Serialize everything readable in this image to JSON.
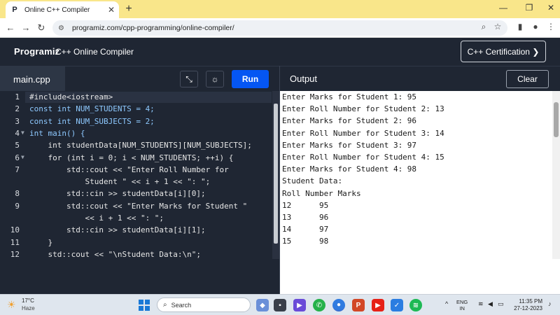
{
  "browser": {
    "tab_title": "Online C++ Compiler",
    "url": "programiz.com/cpp-programming/online-compiler/"
  },
  "site": {
    "logo": "Programiz",
    "title": "C++ Online Compiler",
    "cert_button": "C++ Certification ❯"
  },
  "editor": {
    "filename": "main.cpp",
    "run_label": "Run",
    "line_numbers": [
      "1",
      "2",
      "3",
      "4",
      "5",
      "6",
      "7",
      "",
      "8",
      "9",
      "",
      "10",
      "11",
      "12"
    ],
    "lines": [
      "#include<iostream>",
      "const int NUM_STUDENTS = 4;",
      "const int NUM_SUBJECTS = 2;",
      "int main() {",
      "    int studentData[NUM_STUDENTS][NUM_SUBJECTS];",
      "    for (int i = 0; i < NUM_STUDENTS; ++i) {",
      "        std::cout << \"Enter Roll Number for",
      "            Student \" << i + 1 << \": \";",
      "        std::cin >> studentData[i][0];",
      "        std::cout << \"Enter Marks for Student \"",
      "            << i + 1 << \": \";",
      "        std::cin >> studentData[i][1];",
      "    }",
      "    std::cout << \"\\nStudent Data:\\n\";"
    ]
  },
  "output": {
    "title": "Output",
    "clear_label": "Clear",
    "lines": [
      "Enter Marks for Student 1: 95",
      "Enter Roll Number for Student 2: 13",
      "Enter Marks for Student 2: 96",
      "Enter Roll Number for Student 3: 14",
      "Enter Marks for Student 3: 97",
      "Enter Roll Number for Student 4: 15",
      "Enter Marks for Student 4: 98",
      "Student Data:",
      "Roll Number Marks",
      "12      95",
      "13      96",
      "14      97",
      "15      98"
    ]
  },
  "taskbar": {
    "temperature": "17°C",
    "weather": "Haze",
    "search_label": "Search",
    "lang_top": "ENG",
    "lang_bottom": "IN",
    "time": "11:35 PM",
    "date": "27-12-2023"
  },
  "colors": {
    "run_button": "#0556f3",
    "editor_bg": "#1f2633",
    "tabbar_bg": "#f9e68a"
  }
}
